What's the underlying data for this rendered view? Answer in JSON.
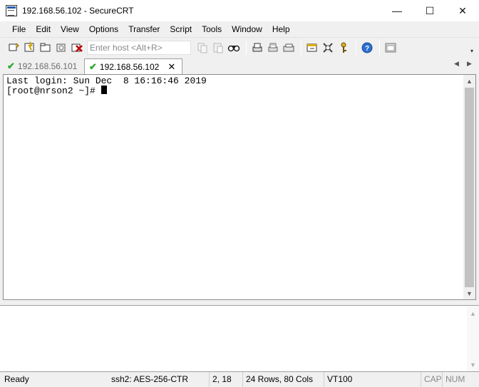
{
  "window": {
    "title": "192.168.56.102 - SecureCRT",
    "controls": {
      "minimize": "—",
      "maximize": "☐",
      "close": "✕"
    }
  },
  "menu": [
    "File",
    "Edit",
    "View",
    "Options",
    "Transfer",
    "Script",
    "Tools",
    "Window",
    "Help"
  ],
  "toolbar": {
    "host_placeholder": "Enter host <Alt+R>",
    "icons_left": [
      "connect-icon",
      "quick-connect-icon",
      "connect-in-tab-icon",
      "reconnect-icon",
      "disconnect-icon"
    ],
    "icons_right": [
      "copy-icon",
      "paste-icon",
      "find-icon",
      "print-icon",
      "print-selection-icon",
      "print-setup-icon",
      "session-options-icon",
      "global-options-icon",
      "keymap-icon",
      "help-icon",
      "sftp-icon"
    ]
  },
  "tabs": [
    {
      "label": "192.168.56.101",
      "active": false
    },
    {
      "label": "192.168.56.102",
      "active": true
    }
  ],
  "terminal": {
    "line1": "Last login: Sun Dec  8 16:16:46 2019",
    "line2": "[root@nrson2 ~]# "
  },
  "status": {
    "ready": "Ready",
    "cipher": "ssh2: AES-256-CTR",
    "cursor_pos": "2,  18",
    "dimensions": "24 Rows, 80 Cols",
    "emulation": "VT100",
    "cap": "CAP",
    "num": "NUM"
  },
  "colors": {
    "check": "#2fa62f",
    "accent": "#2a5db0"
  }
}
